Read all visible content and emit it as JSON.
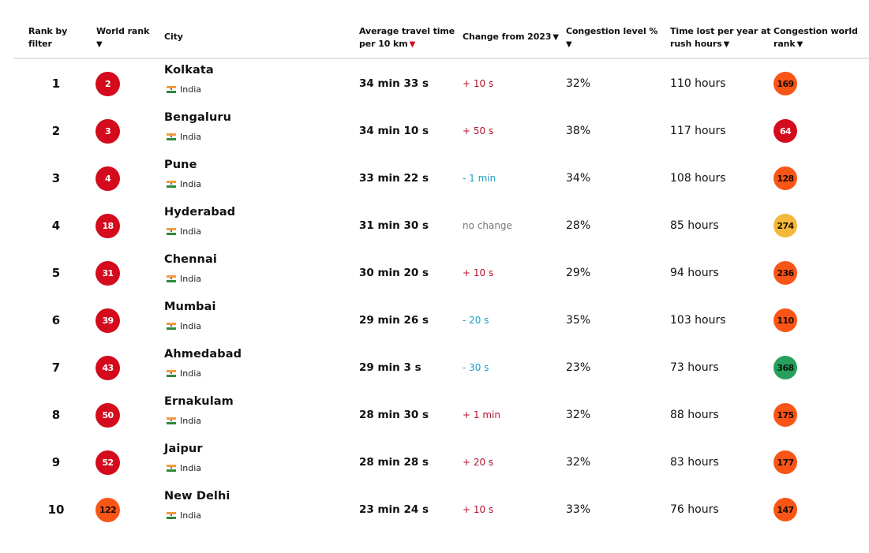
{
  "headers": {
    "rank_by_filter": "Rank by filter",
    "rank_by_filter_l1": "Rank by",
    "rank_by_filter_l2": "filter",
    "world_rank": "World rank",
    "city": "City",
    "avg_travel_l1": "Average travel time",
    "avg_travel_l2": "per 10 km",
    "change": "Change from 2023",
    "congestion_level": "Congestion level %",
    "time_lost_l1": "Time lost per year at",
    "time_lost_l2": "rush hours",
    "cong_world_rank_l1": "Congestion world",
    "cong_world_rank_l2": "rank",
    "sort_arrow": "▼"
  },
  "colors": {
    "rank_red": "#d40b1c",
    "rank_orange": "#f95516",
    "rank_amber": "#f4b83a",
    "rank_green": "#26a05c",
    "change_increase": "#b3132b",
    "change_decrease": "#1a9fc6",
    "change_none": "#777777",
    "active_sort_arrow": "#d0021b"
  },
  "rows": [
    {
      "rank": "1",
      "world_rank": "2",
      "world_rank_color": "red",
      "city": "Kolkata",
      "country": "India",
      "flag": "india-flag-icon",
      "travel_time": "34 min 33 s",
      "change": "+ 10 s",
      "change_type": "up",
      "congestion": "32%",
      "time_lost": "110 hours",
      "cong_rank": "169",
      "cong_rank_color": "orange"
    },
    {
      "rank": "2",
      "world_rank": "3",
      "world_rank_color": "red",
      "city": "Bengaluru",
      "country": "India",
      "flag": "india-flag-icon",
      "travel_time": "34 min 10 s",
      "change": "+ 50 s",
      "change_type": "up",
      "congestion": "38%",
      "time_lost": "117 hours",
      "cong_rank": "64",
      "cong_rank_color": "red"
    },
    {
      "rank": "3",
      "world_rank": "4",
      "world_rank_color": "red",
      "city": "Pune",
      "country": "India",
      "flag": "india-flag-icon",
      "travel_time": "33 min 22 s",
      "change": "- 1 min",
      "change_type": "down",
      "congestion": "34%",
      "time_lost": "108 hours",
      "cong_rank": "128",
      "cong_rank_color": "orange"
    },
    {
      "rank": "4",
      "world_rank": "18",
      "world_rank_color": "red",
      "city": "Hyderabad",
      "country": "India",
      "flag": "india-flag-icon",
      "travel_time": "31 min 30 s",
      "change": "no change",
      "change_type": "none",
      "congestion": "28%",
      "time_lost": "85 hours",
      "cong_rank": "274",
      "cong_rank_color": "amber"
    },
    {
      "rank": "5",
      "world_rank": "31",
      "world_rank_color": "red",
      "city": "Chennai",
      "country": "India",
      "flag": "india-flag-icon",
      "travel_time": "30 min 20 s",
      "change": "+ 10 s",
      "change_type": "up",
      "congestion": "29%",
      "time_lost": "94 hours",
      "cong_rank": "236",
      "cong_rank_color": "orange"
    },
    {
      "rank": "6",
      "world_rank": "39",
      "world_rank_color": "red",
      "city": "Mumbai",
      "country": "India",
      "flag": "india-flag-icon",
      "travel_time": "29 min 26 s",
      "change": "- 20 s",
      "change_type": "down",
      "congestion": "35%",
      "time_lost": "103 hours",
      "cong_rank": "110",
      "cong_rank_color": "orange"
    },
    {
      "rank": "7",
      "world_rank": "43",
      "world_rank_color": "red",
      "city": "Ahmedabad",
      "country": "India",
      "flag": "india-flag-icon",
      "travel_time": "29 min 3 s",
      "change": "- 30 s",
      "change_type": "down",
      "congestion": "23%",
      "time_lost": "73 hours",
      "cong_rank": "368",
      "cong_rank_color": "green"
    },
    {
      "rank": "8",
      "world_rank": "50",
      "world_rank_color": "red",
      "city": "Ernakulam",
      "country": "India",
      "flag": "india-flag-icon",
      "travel_time": "28 min 30 s",
      "change": "+ 1 min",
      "change_type": "up",
      "congestion": "32%",
      "time_lost": "88 hours",
      "cong_rank": "175",
      "cong_rank_color": "orange"
    },
    {
      "rank": "9",
      "world_rank": "52",
      "world_rank_color": "red",
      "city": "Jaipur",
      "country": "India",
      "flag": "india-flag-icon",
      "travel_time": "28 min 28 s",
      "change": "+ 20 s",
      "change_type": "up",
      "congestion": "32%",
      "time_lost": "83 hours",
      "cong_rank": "177",
      "cong_rank_color": "orange"
    },
    {
      "rank": "10",
      "world_rank": "122",
      "world_rank_color": "orange",
      "city": "New Delhi",
      "country": "India",
      "flag": "india-flag-icon",
      "travel_time": "23 min 24 s",
      "change": "+ 10 s",
      "change_type": "up",
      "congestion": "33%",
      "time_lost": "76 hours",
      "cong_rank": "147",
      "cong_rank_color": "orange"
    }
  ]
}
